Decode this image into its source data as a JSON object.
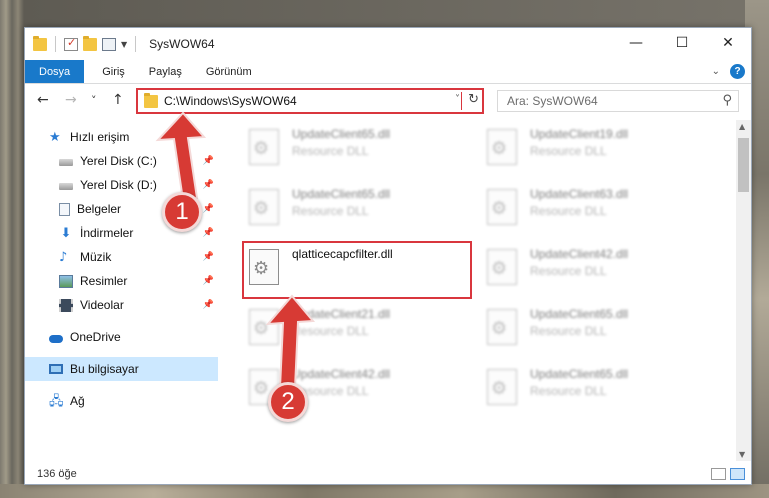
{
  "window": {
    "title": "SysWOW64"
  },
  "title_controls": [
    "—",
    "☐",
    "✕"
  ],
  "ribbon": {
    "tabs": [
      "Dosya",
      "Giriş",
      "Paylaş",
      "Görünüm"
    ],
    "active_tab": "Dosya",
    "help": "?"
  },
  "nav": {
    "back": "←",
    "forward": "→",
    "recent": "˅",
    "up": "↑"
  },
  "address": {
    "path": "C:\\Windows\\SysWOW64",
    "dropdown": "˅",
    "refresh": "↻"
  },
  "search": {
    "placeholder": "Ara: SysWOW64",
    "icon": "search-icon"
  },
  "sidebar": {
    "items": [
      {
        "label": "Hızlı erişim",
        "icon": "star-icon",
        "pinned": false
      },
      {
        "label": "Yerel Disk (C:)",
        "icon": "drive-icon",
        "pinned": true
      },
      {
        "label": "Yerel Disk (D:)",
        "icon": "drive-icon",
        "pinned": true
      },
      {
        "label": "Belgeler",
        "icon": "documents-icon",
        "pinned": true
      },
      {
        "label": "İndirmeler",
        "icon": "download-icon",
        "pinned": true
      },
      {
        "label": "Müzik",
        "icon": "music-icon",
        "pinned": true
      },
      {
        "label": "Resimler",
        "icon": "pictures-icon",
        "pinned": true
      },
      {
        "label": "Videolar",
        "icon": "video-icon",
        "pinned": true
      },
      {
        "label": "OneDrive",
        "icon": "cloud-icon",
        "pinned": false
      },
      {
        "label": "Bu bilgisayar",
        "icon": "computer-icon",
        "pinned": false,
        "selected": true
      },
      {
        "label": "Ağ",
        "icon": "network-icon",
        "pinned": false
      }
    ]
  },
  "files": [
    {
      "name": "UpdateClient65.dll",
      "desc": "Resource DLL",
      "blurred": true
    },
    {
      "name": "UpdateClient19.dll",
      "desc": "Resource DLL",
      "blurred": true
    },
    {
      "name": "UpdateClient65.dll",
      "desc": "Resource DLL",
      "blurred": true
    },
    {
      "name": "UpdateClient63.dll",
      "desc": "Resource DLL",
      "blurred": true
    },
    {
      "name": "qlatticecapcfilter.dll",
      "desc": "",
      "blurred": false
    },
    {
      "name": "UpdateClient42.dll",
      "desc": "Resource DLL",
      "blurred": true
    },
    {
      "name": "UpdateClient21.dll",
      "desc": "Resource DLL",
      "blurred": true
    },
    {
      "name": "UpdateClient65.dll",
      "desc": "Resource DLL",
      "blurred": true
    },
    {
      "name": "UpdateClient42.dll",
      "desc": "Resource DLL",
      "blurred": true
    },
    {
      "name": "UpdateClient65.dll",
      "desc": "Resource DLL",
      "blurred": true
    }
  ],
  "status": {
    "count": "136 öğe"
  },
  "callouts": [
    "1",
    "2"
  ],
  "colors": {
    "accent": "#1979ca",
    "highlight": "#d9363e",
    "callout": "#d73a34",
    "selected": "#cce8ff"
  }
}
